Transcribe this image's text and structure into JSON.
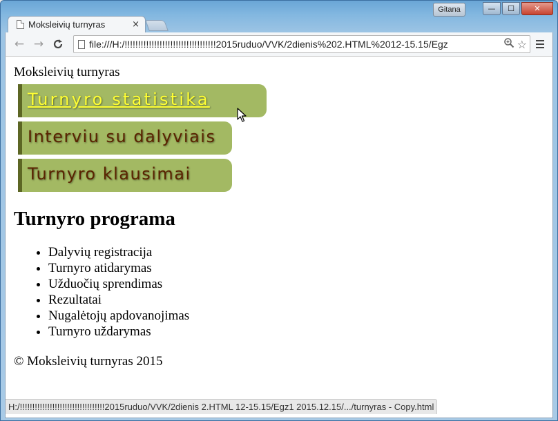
{
  "window": {
    "user_badge": "Gitana",
    "minimize_label": "—",
    "maximize_label": "☐",
    "close_label": "✕"
  },
  "tab": {
    "title": "Moksleivių turnyras",
    "close_label": "×"
  },
  "toolbar": {
    "back_label": "←",
    "forward_label": "→",
    "reload_label": "C",
    "url": "file:///H:/!!!!!!!!!!!!!!!!!!!!!!!!!!!!!!!!!!2015ruduo/VVK/2dienis%202.HTML%2012-15.15/Egz",
    "zoom_icon": "⚲",
    "star_icon": "☆"
  },
  "page": {
    "site_title": "Moksleivių turnyras",
    "nav": [
      {
        "label": "Turnyro statistika"
      },
      {
        "label": "Interviu su dalyviais"
      },
      {
        "label": "Turnyro klausimai"
      }
    ],
    "heading": "Turnyro programa",
    "program": [
      "Dalyvių registracija",
      "Turnyro atidarymas",
      "Užduočių sprendimas",
      "Rezultatai",
      "Nugalėtojų apdovanojimas",
      "Turnyro uždarymas"
    ],
    "footer": "© Moksleivių turnyras 2015"
  },
  "statusbar": {
    "text": "H:/!!!!!!!!!!!!!!!!!!!!!!!!!!!!!!!!!!2015ruduo/VVK/2dienis 2.HTML 12-15.15/Egz1 2015.12.15/.../turnyras - Copy.html"
  },
  "colors": {
    "nav_background": "#a3b963",
    "nav_border": "#5c6624",
    "nav_text": "#5a2300",
    "nav_hover_text": "#ffff33"
  }
}
